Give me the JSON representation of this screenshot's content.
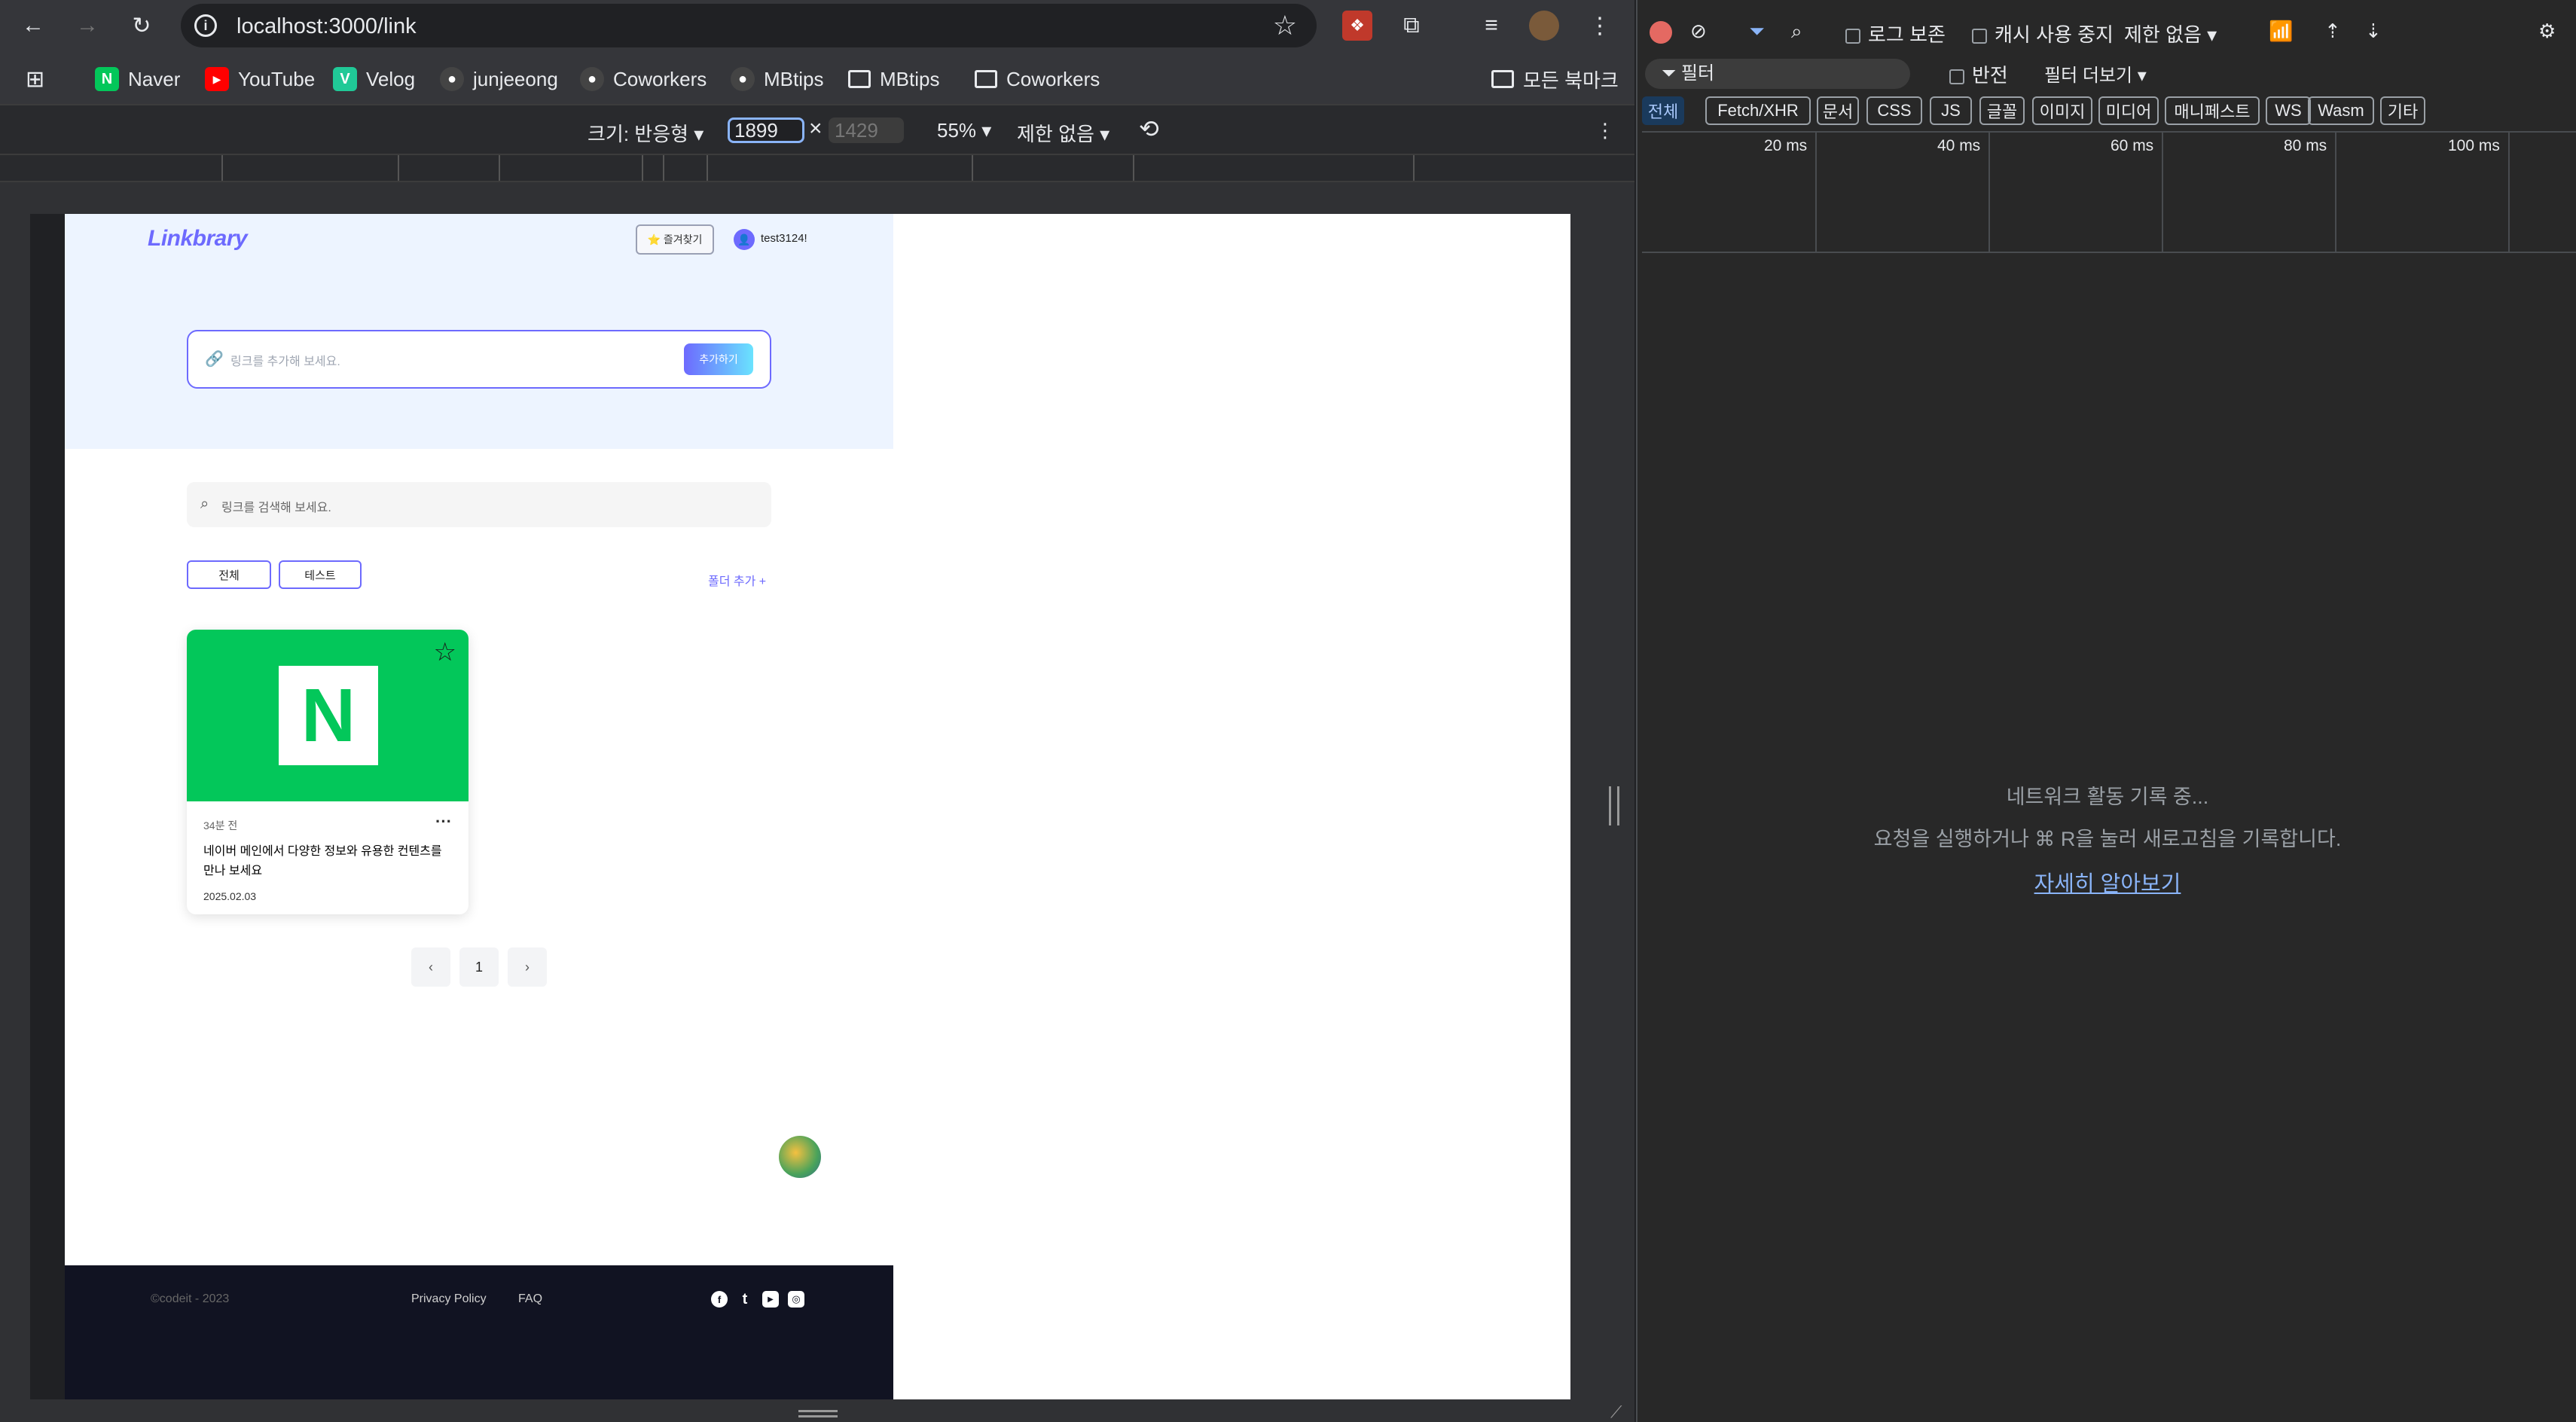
{
  "browser": {
    "url": "localhost:3000/link",
    "bookmarks": [
      {
        "label": "Naver",
        "icon": "naver-icon",
        "color": "#03c75a",
        "glyph": "N"
      },
      {
        "label": "YouTube",
        "icon": "youtube-icon",
        "color": "#ff0000",
        "glyph": "▶"
      },
      {
        "label": "Velog",
        "icon": "velog-icon",
        "color": "#20c997",
        "glyph": "V"
      },
      {
        "label": "junjeeong",
        "icon": "github-icon",
        "color": "#444",
        "glyph": "●"
      },
      {
        "label": "Coworkers",
        "icon": "github-icon",
        "color": "#444",
        "glyph": "●"
      },
      {
        "label": "MBtips",
        "icon": "github-icon",
        "color": "#444",
        "glyph": "●"
      },
      {
        "label": "MBtips",
        "icon": "folder-icon",
        "color": "transparent",
        "glyph": "🗀"
      },
      {
        "label": "Coworkers",
        "icon": "folder-icon",
        "color": "transparent",
        "glyph": "🗀"
      }
    ],
    "all_bookmarks": "모든 북마크"
  },
  "device_toolbar": {
    "size_label": "크기: 반응형",
    "width": "1899",
    "times": "×",
    "height_placeholder": "1429",
    "zoom": "55%",
    "throttle": "제한 없음"
  },
  "page": {
    "logo": "Linkbrary",
    "favorites_button": "⭐ 즐겨찾기",
    "avatar_glyph": "👤",
    "username": "test3124!",
    "add_link": {
      "placeholder": "링크를 추가해 보세요.",
      "button": "추가하기"
    },
    "search": {
      "placeholder": "링크를 검색해 보세요."
    },
    "folders": [
      "전체",
      "테스트"
    ],
    "add_folder": "폴더 추가 +",
    "card": {
      "time_ago": "34분 전",
      "description": "네이버 메인에서 다양한 정보와 유용한 컨텐츠를 만나 보세요",
      "date": "2025.02.03",
      "thumb_letter": "N"
    },
    "pagination": {
      "prev": "‹",
      "page": "1",
      "next": "›"
    },
    "footer": {
      "copyright": "©codeit - 2023",
      "privacy": "Privacy Policy",
      "faq": "FAQ",
      "social": [
        "f",
        "t",
        "▶",
        "◎"
      ]
    }
  },
  "devtools": {
    "preserve_log": "로그 보존",
    "disable_cache": "캐시 사용 중지",
    "throttle": "제한 없음",
    "filter_placeholder": "필터",
    "invert": "반전",
    "more_filters": "필터 더보기",
    "chips": [
      "전체",
      "Fetch/XHR",
      "문서",
      "CSS",
      "JS",
      "글꼴",
      "이미지",
      "미디어",
      "매니페스트",
      "WS",
      "Wasm",
      "기타"
    ],
    "timeline_labels": [
      "20 ms",
      "40 ms",
      "60 ms",
      "80 ms",
      "100 ms"
    ],
    "empty_message": "네트워크 활동 기록 중...",
    "empty_hint": "요청을 실행하거나 ⌘ R을 눌러 새로고침을 기록합니다.",
    "learn_more": "자세히 알아보기"
  }
}
